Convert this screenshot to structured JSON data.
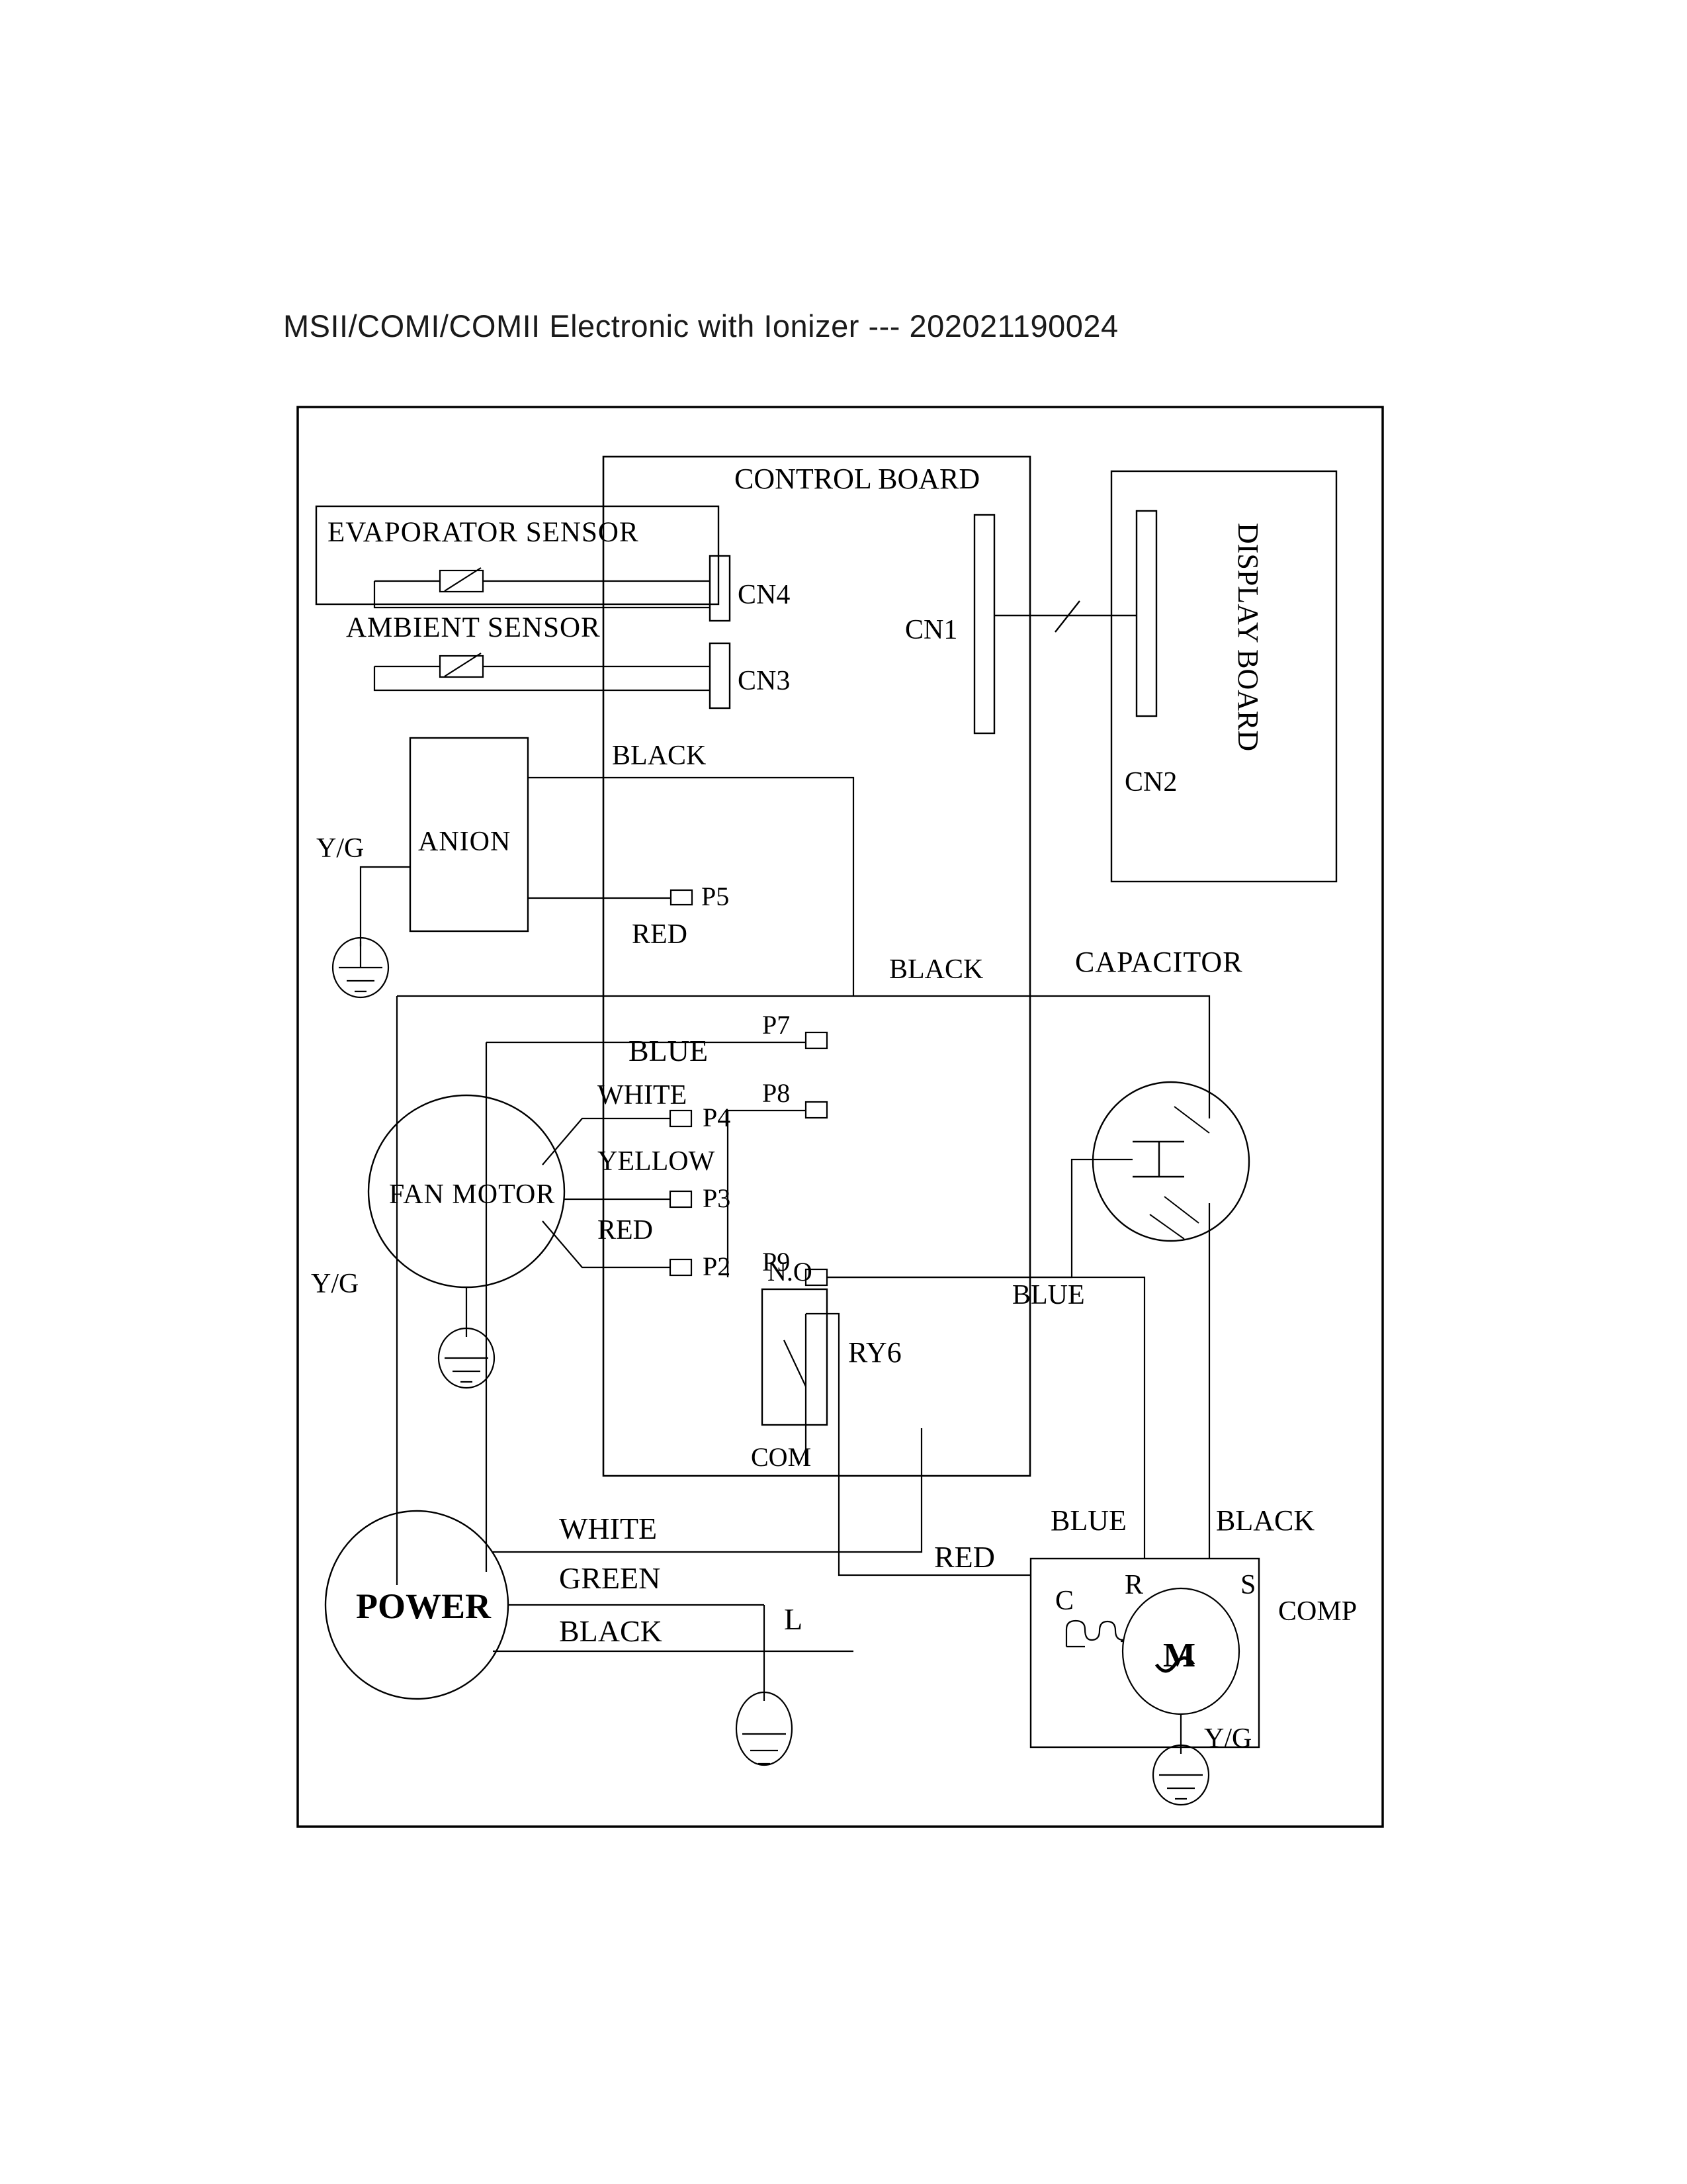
{
  "title": "MSII/COMI/COMII Electronic with Ionizer --- 202021190024",
  "diagram": {
    "type": "wiring-schematic",
    "boards": {
      "control_board": "CONTROL BOARD",
      "display_board": "DISPLAY BOARD"
    },
    "connectors": {
      "cn1": "CN1",
      "cn2": "CN2",
      "cn3": "CN3",
      "cn4": "CN4"
    },
    "sensors": {
      "evaporator": "EVAPORATOR SENSOR",
      "ambient": "AMBIENT SENSOR"
    },
    "components": {
      "anion": "ANION",
      "fan_motor": "FAN MOTOR",
      "capacitor": "CAPACITOR",
      "power": "POWER",
      "comp": "COMP",
      "relay": "RY6",
      "motor_symbol": "M"
    },
    "relay_terminals": {
      "no": "N.O",
      "com": "COM"
    },
    "comp_terminals": {
      "r": "R",
      "s": "S",
      "c": "C"
    },
    "pins": {
      "p2": "P2",
      "p3": "P3",
      "p4": "P4",
      "p5": "P5",
      "p7": "P7",
      "p8": "P8",
      "p9": "P9"
    },
    "wire_labels": {
      "anion_black": "BLACK",
      "anion_red": "RED",
      "fan_blue": "BLUE",
      "fan_white": "WHITE",
      "fan_yellow": "YELLOW",
      "fan_red": "RED",
      "cap_black": "BLACK",
      "cap_blue": "BLUE",
      "comp_blue": "BLUE",
      "comp_black": "BLACK",
      "comp_red": "RED",
      "power_white": "WHITE",
      "power_green": "GREEN",
      "power_black": "BLACK"
    },
    "ground_labels": {
      "anion_ground": "Y/G",
      "fan_ground": "Y/G",
      "comp_ground": "Y/G"
    },
    "misc": {
      "line_label_l": "L"
    }
  }
}
